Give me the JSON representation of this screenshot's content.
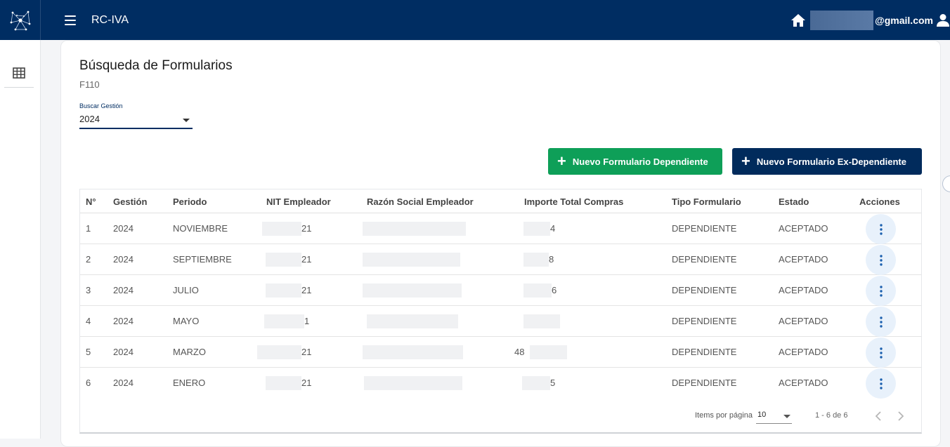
{
  "header": {
    "app_title": "RC-IVA",
    "email_suffix": "@gmail.com"
  },
  "page": {
    "title": "Búsqueda de Formularios",
    "subtitle": "F110"
  },
  "filter": {
    "label": "Buscar Gestión",
    "value": "2024"
  },
  "buttons": {
    "new_dependent": "Nuevo Formulario Dependiente",
    "new_ex_dependent": "Nuevo Formulario Ex-Dependiente"
  },
  "table": {
    "headers": [
      "N°",
      "Gestión",
      "Periodo",
      "NIT Empleador",
      "Razón Social Empleador",
      "Importe Total Compras",
      "Tipo Formulario",
      "Estado",
      "Acciones"
    ],
    "rows": [
      {
        "n": "1",
        "gestion": "2024",
        "periodo": "NOVIEMBRE",
        "nit_tail": "21",
        "importe_tail": "4",
        "tipo": "DEPENDIENTE",
        "estado": "ACEPTADO"
      },
      {
        "n": "2",
        "gestion": "2024",
        "periodo": "SEPTIEMBRE",
        "nit_tail": "21",
        "importe_tail": "8",
        "tipo": "DEPENDIENTE",
        "estado": "ACEPTADO"
      },
      {
        "n": "3",
        "gestion": "2024",
        "periodo": "JULIO",
        "nit_tail": "21",
        "importe_tail": "6",
        "tipo": "DEPENDIENTE",
        "estado": "ACEPTADO"
      },
      {
        "n": "4",
        "gestion": "2024",
        "periodo": "MAYO",
        "nit_tail": "1",
        "importe_tail": "",
        "tipo": "DEPENDIENTE",
        "estado": "ACEPTADO"
      },
      {
        "n": "5",
        "gestion": "2024",
        "periodo": "MARZO",
        "nit_tail": "21",
        "importe_tail": "48",
        "tipo": "DEPENDIENTE",
        "estado": "ACEPTADO"
      },
      {
        "n": "6",
        "gestion": "2024",
        "periodo": "ENERO",
        "nit_tail": "21",
        "importe_tail": "5",
        "tipo": "DEPENDIENTE",
        "estado": "ACEPTADO"
      }
    ]
  },
  "paginator": {
    "items_label": "Items por página",
    "page_size": "10",
    "range": "1 - 6 de 6"
  },
  "icons": {
    "logo": "network-logo-icon",
    "menu": "hamburger-menu-icon",
    "home": "home-icon",
    "user": "user-icon",
    "grid": "grid-table-icon",
    "row_action": "more-vert-icon",
    "prev": "chevron-left-icon",
    "next": "chevron-right-icon"
  },
  "colors": {
    "header_bg": "#002d62",
    "green_button": "#0e9f58",
    "navy_button": "#012b5c",
    "action_circle": "#e8f1fb",
    "action_dots": "#1b5fae"
  }
}
